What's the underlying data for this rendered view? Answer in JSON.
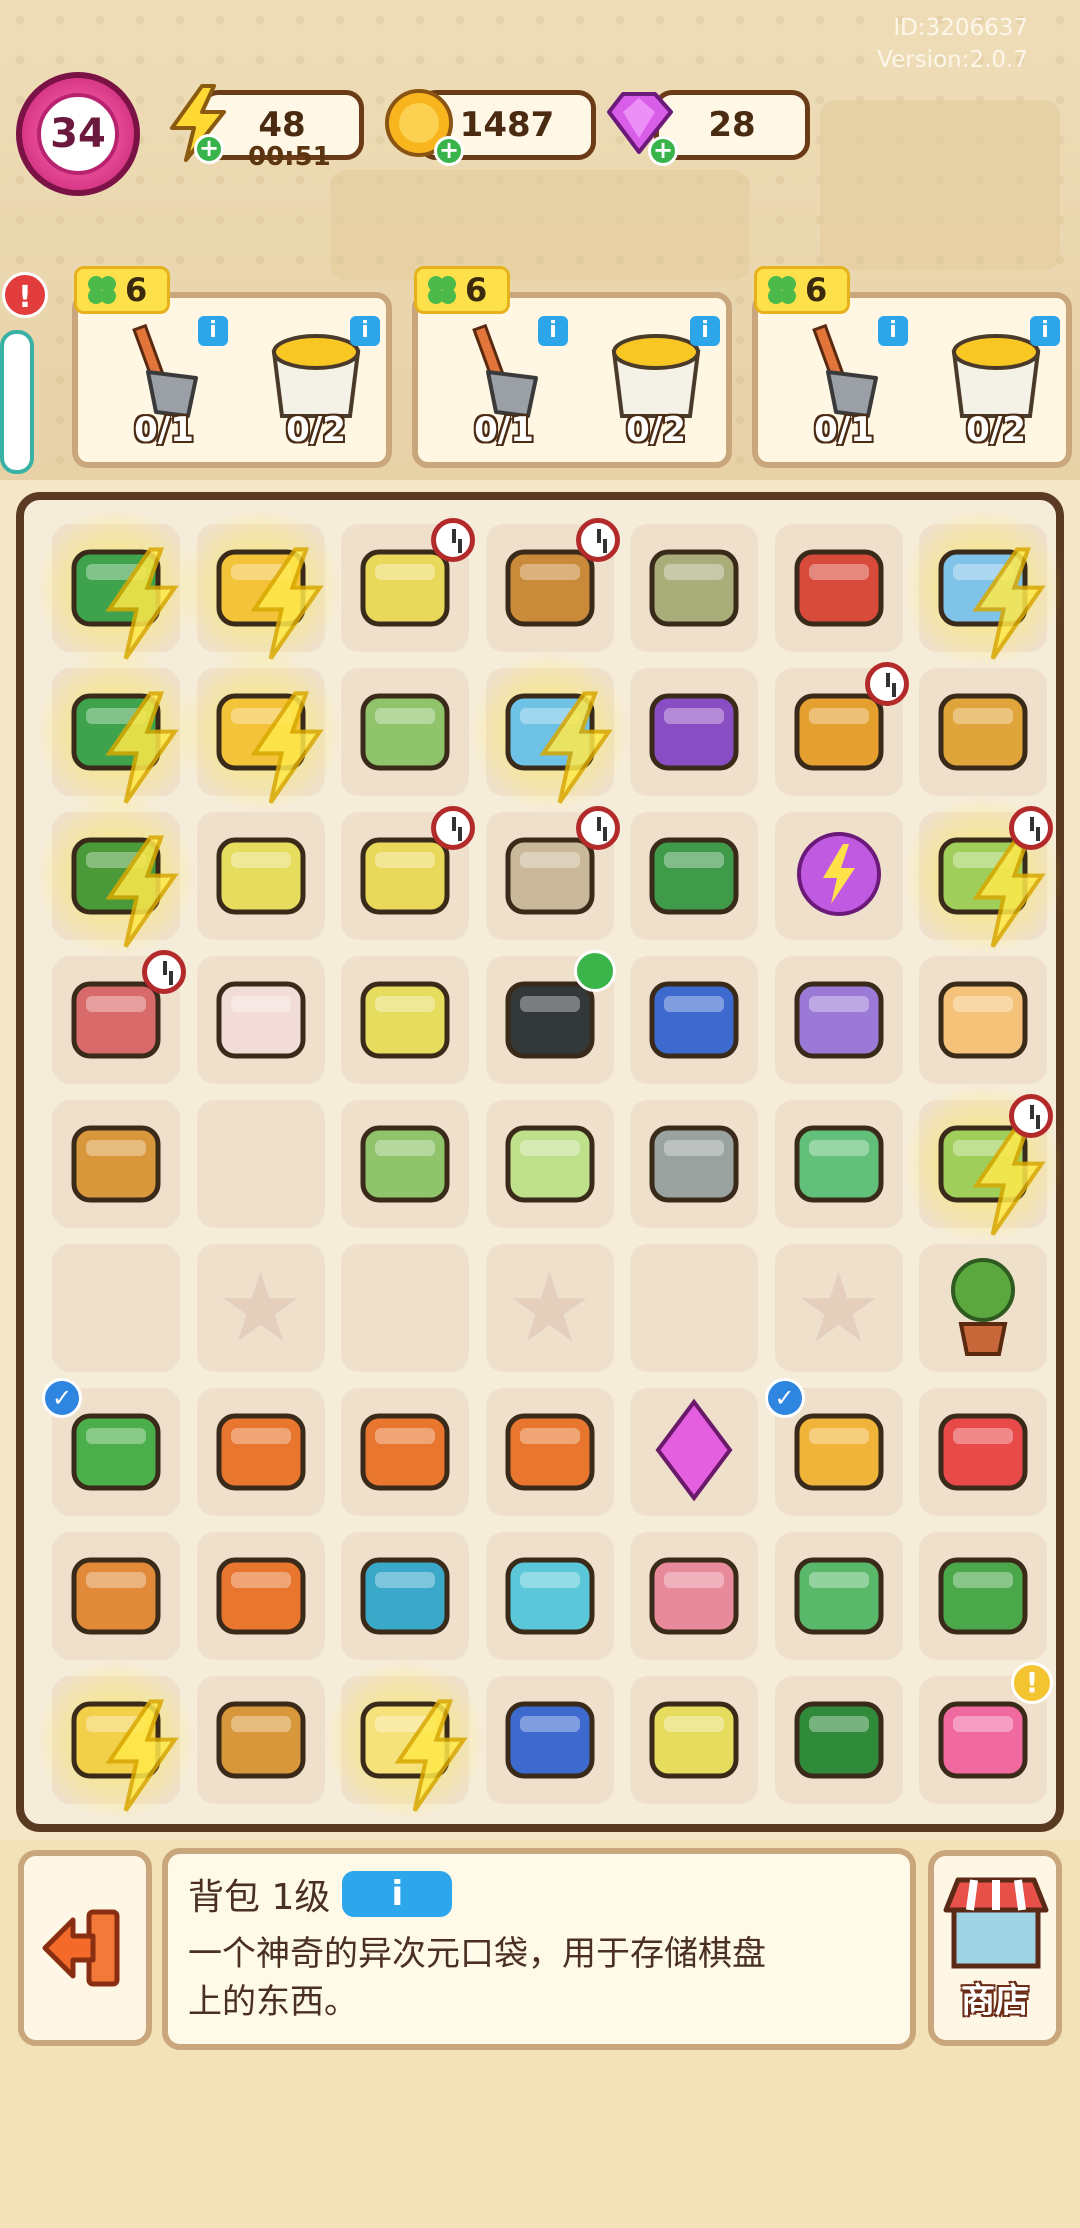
{
  "header": {
    "id_text": "ID:3206637",
    "version_text": "Version:2.0.7",
    "level": "34",
    "energy": "48",
    "energy_timer": "00:51",
    "coins": "1487",
    "gems": "28"
  },
  "orders": [
    {
      "reward": "6",
      "items": [
        {
          "icon": "shovel-icon",
          "count": "0/1"
        },
        {
          "icon": "paint-bucket-icon",
          "count": "0/2"
        }
      ]
    },
    {
      "reward": "6",
      "items": [
        {
          "icon": "shovel-icon",
          "count": "0/1"
        },
        {
          "icon": "paint-bucket-icon",
          "count": "0/2"
        }
      ]
    },
    {
      "reward": "6",
      "items": [
        {
          "icon": "shovel-icon",
          "count": "0/1"
        },
        {
          "icon": "paint-bucket-icon",
          "count": "0/2"
        }
      ]
    }
  ],
  "board": {
    "rows": [
      [
        "money-box-icon",
        "bucket-icon",
        "toolcart-icon",
        "flower-basket-icon",
        "sandbag-stack-icon",
        "sling-bag-icon",
        "fishbowl-icon"
      ],
      [
        "money-box-icon",
        "bucket-icon",
        "garden-glove-icon",
        "ice-box-icon",
        "purple-toolbox-icon",
        "cabinet-icon",
        "paper-bag-icon"
      ],
      [
        "money-bag-icon",
        "basket-icon",
        "toolcart-icon",
        "locker-icon",
        "green-case-icon",
        "energy-orb-icon",
        "laptop-icon"
      ],
      [
        "wheelbarrow-icon",
        "open-box-icon",
        "frame-icon",
        "black-bag-icon",
        "drill-icon",
        "book-icon",
        "kitten-icon"
      ],
      [
        "carton-icon",
        "",
        "garden-glove-icon",
        "paint-tube-icon",
        "tape-measure-icon",
        "cash-bundle-icon",
        "laptop-icon"
      ],
      [
        "",
        "star",
        "",
        "star",
        "",
        "star",
        "plant-pot-icon"
      ],
      [
        "hacksaw-icon",
        "paint-roller-icon",
        "trowel-icon",
        "cutter-knife-icon",
        "gem-icon",
        "drawer-icon",
        "medal-icon"
      ],
      [
        "sanding-block-icon",
        "pickaxe-icon",
        "hand-grip-icon",
        "tape-icon",
        "bricks-icon",
        "money-stack-icon",
        "wrench-icon"
      ],
      [
        "shopping-cart-icon",
        "carton-icon",
        "chick-cart-icon",
        "cd-player-icon",
        "basket-icon",
        "green-toolbox-icon",
        "backpack-icon"
      ]
    ]
  },
  "item_info": {
    "name": "背包 1级",
    "info_button": "i",
    "description_line1": "一个神奇的异次元口袋，用于存储棋盘",
    "description_line2": "上的东西。"
  },
  "shop": {
    "label": "商店"
  },
  "colors": {
    "accent_pink": "#e0418f",
    "energy_yellow": "#fde04a",
    "info_blue": "#2ea6ec",
    "board_border": "#5a3a22"
  }
}
